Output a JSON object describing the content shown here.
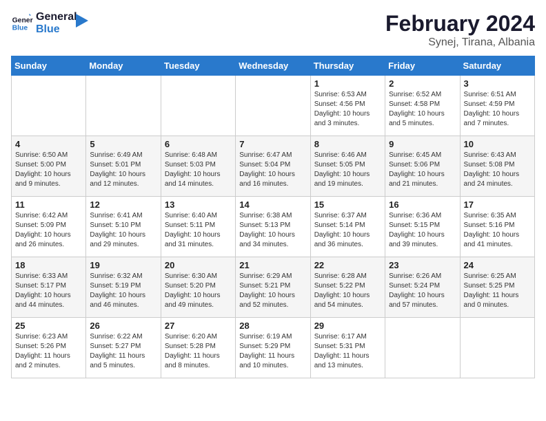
{
  "logo": {
    "line1": "General",
    "line2": "Blue"
  },
  "title": "February 2024",
  "subtitle": "Synej, Tirana, Albania",
  "days_of_week": [
    "Sunday",
    "Monday",
    "Tuesday",
    "Wednesday",
    "Thursday",
    "Friday",
    "Saturday"
  ],
  "weeks": [
    [
      {
        "day": "",
        "info": ""
      },
      {
        "day": "",
        "info": ""
      },
      {
        "day": "",
        "info": ""
      },
      {
        "day": "",
        "info": ""
      },
      {
        "day": "1",
        "info": "Sunrise: 6:53 AM\nSunset: 4:56 PM\nDaylight: 10 hours\nand 3 minutes."
      },
      {
        "day": "2",
        "info": "Sunrise: 6:52 AM\nSunset: 4:58 PM\nDaylight: 10 hours\nand 5 minutes."
      },
      {
        "day": "3",
        "info": "Sunrise: 6:51 AM\nSunset: 4:59 PM\nDaylight: 10 hours\nand 7 minutes."
      }
    ],
    [
      {
        "day": "4",
        "info": "Sunrise: 6:50 AM\nSunset: 5:00 PM\nDaylight: 10 hours\nand 9 minutes."
      },
      {
        "day": "5",
        "info": "Sunrise: 6:49 AM\nSunset: 5:01 PM\nDaylight: 10 hours\nand 12 minutes."
      },
      {
        "day": "6",
        "info": "Sunrise: 6:48 AM\nSunset: 5:03 PM\nDaylight: 10 hours\nand 14 minutes."
      },
      {
        "day": "7",
        "info": "Sunrise: 6:47 AM\nSunset: 5:04 PM\nDaylight: 10 hours\nand 16 minutes."
      },
      {
        "day": "8",
        "info": "Sunrise: 6:46 AM\nSunset: 5:05 PM\nDaylight: 10 hours\nand 19 minutes."
      },
      {
        "day": "9",
        "info": "Sunrise: 6:45 AM\nSunset: 5:06 PM\nDaylight: 10 hours\nand 21 minutes."
      },
      {
        "day": "10",
        "info": "Sunrise: 6:43 AM\nSunset: 5:08 PM\nDaylight: 10 hours\nand 24 minutes."
      }
    ],
    [
      {
        "day": "11",
        "info": "Sunrise: 6:42 AM\nSunset: 5:09 PM\nDaylight: 10 hours\nand 26 minutes."
      },
      {
        "day": "12",
        "info": "Sunrise: 6:41 AM\nSunset: 5:10 PM\nDaylight: 10 hours\nand 29 minutes."
      },
      {
        "day": "13",
        "info": "Sunrise: 6:40 AM\nSunset: 5:11 PM\nDaylight: 10 hours\nand 31 minutes."
      },
      {
        "day": "14",
        "info": "Sunrise: 6:38 AM\nSunset: 5:13 PM\nDaylight: 10 hours\nand 34 minutes."
      },
      {
        "day": "15",
        "info": "Sunrise: 6:37 AM\nSunset: 5:14 PM\nDaylight: 10 hours\nand 36 minutes."
      },
      {
        "day": "16",
        "info": "Sunrise: 6:36 AM\nSunset: 5:15 PM\nDaylight: 10 hours\nand 39 minutes."
      },
      {
        "day": "17",
        "info": "Sunrise: 6:35 AM\nSunset: 5:16 PM\nDaylight: 10 hours\nand 41 minutes."
      }
    ],
    [
      {
        "day": "18",
        "info": "Sunrise: 6:33 AM\nSunset: 5:17 PM\nDaylight: 10 hours\nand 44 minutes."
      },
      {
        "day": "19",
        "info": "Sunrise: 6:32 AM\nSunset: 5:19 PM\nDaylight: 10 hours\nand 46 minutes."
      },
      {
        "day": "20",
        "info": "Sunrise: 6:30 AM\nSunset: 5:20 PM\nDaylight: 10 hours\nand 49 minutes."
      },
      {
        "day": "21",
        "info": "Sunrise: 6:29 AM\nSunset: 5:21 PM\nDaylight: 10 hours\nand 52 minutes."
      },
      {
        "day": "22",
        "info": "Sunrise: 6:28 AM\nSunset: 5:22 PM\nDaylight: 10 hours\nand 54 minutes."
      },
      {
        "day": "23",
        "info": "Sunrise: 6:26 AM\nSunset: 5:24 PM\nDaylight: 10 hours\nand 57 minutes."
      },
      {
        "day": "24",
        "info": "Sunrise: 6:25 AM\nSunset: 5:25 PM\nDaylight: 11 hours\nand 0 minutes."
      }
    ],
    [
      {
        "day": "25",
        "info": "Sunrise: 6:23 AM\nSunset: 5:26 PM\nDaylight: 11 hours\nand 2 minutes."
      },
      {
        "day": "26",
        "info": "Sunrise: 6:22 AM\nSunset: 5:27 PM\nDaylight: 11 hours\nand 5 minutes."
      },
      {
        "day": "27",
        "info": "Sunrise: 6:20 AM\nSunset: 5:28 PM\nDaylight: 11 hours\nand 8 minutes."
      },
      {
        "day": "28",
        "info": "Sunrise: 6:19 AM\nSunset: 5:29 PM\nDaylight: 11 hours\nand 10 minutes."
      },
      {
        "day": "29",
        "info": "Sunrise: 6:17 AM\nSunset: 5:31 PM\nDaylight: 11 hours\nand 13 minutes."
      },
      {
        "day": "",
        "info": ""
      },
      {
        "day": "",
        "info": ""
      }
    ]
  ]
}
